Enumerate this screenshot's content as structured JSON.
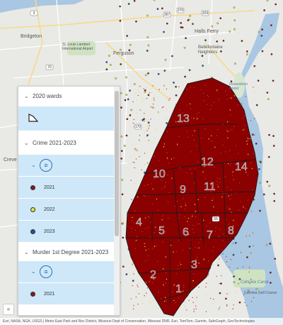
{
  "map": {
    "places": [
      {
        "name": "Bridgeton",
        "class": "land"
      },
      {
        "name": "Ferguson",
        "class": "land"
      },
      {
        "name": "Halls Ferry",
        "class": "land"
      },
      {
        "name": "Bellefontaine Neighbors",
        "class": "land"
      },
      {
        "name": "St. Louis Lambert International Airport",
        "class": "land"
      },
      {
        "name": "Mosenthein Island",
        "class": "water"
      },
      {
        "name": "Cahokia Canal",
        "class": "water"
      },
      {
        "name": "Cahokia Golf Course",
        "class": "land"
      },
      {
        "name": "Creve",
        "class": "land"
      }
    ],
    "ward_labels": [
      "13",
      "12",
      "14",
      "10",
      "9",
      "11",
      "4",
      "5",
      "6",
      "7",
      "8",
      "3",
      "2",
      "1"
    ],
    "route_shields": [
      "367",
      "270",
      "70",
      "170",
      "67",
      "203",
      "3",
      "55"
    ],
    "colors": {
      "crime": "#8b0000",
      "murder": "#8b0000",
      "ward_line": "#1a1a1a",
      "water": "#a9c7e2",
      "land": "#e9eae6",
      "park": "#cfe3c2"
    }
  },
  "layer_list": {
    "groups": [
      {
        "title": "2020 wards",
        "expanded": true,
        "icon": "polygon-icon"
      },
      {
        "title": "Crime 2021-2023",
        "expanded": true,
        "classes": [
          {
            "label": "2021",
            "color": "#8b1a1a"
          },
          {
            "label": "2022",
            "color": "#e2e23a"
          },
          {
            "label": "2023",
            "color": "#2a4fa0"
          }
        ]
      },
      {
        "title": "Murder 1st Degree 2021-2023",
        "expanded": true,
        "classes": [
          {
            "label": "2021",
            "color": "#8b1a1a"
          }
        ]
      }
    ]
  },
  "attribution": "Esri, NASA, NGA, USGS | Metro East Park and Rec District, Missouri Dept of Conservation, Missouri DNR, Esri, TomTom, Garmin, SafeGraph, GeoTechnologies"
}
